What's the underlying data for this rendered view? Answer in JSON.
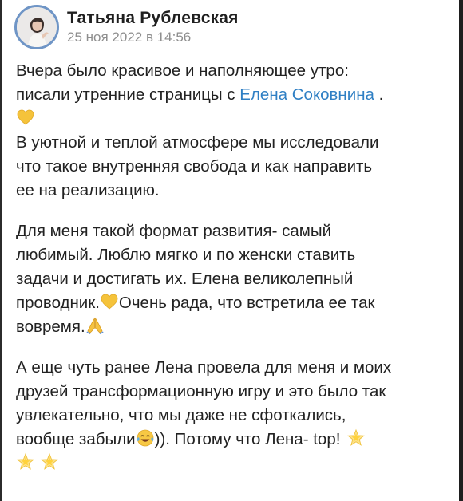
{
  "post": {
    "author": "Татьяна Рублевская",
    "date": "25 ноя 2022 в 14:56",
    "paragraph1": {
      "line1": "Вчера было красивое и наполняющее утро:",
      "line2_pre": "писали утренние страницы с ",
      "mention": "Елена Соковнина",
      "line2_post": " .",
      "line3": "В уютной и теплой атмосфере мы исследовали",
      "line4": "что такое внутренняя свобода и как направить",
      "line5": "ее на реализацию."
    },
    "paragraph2": {
      "line1": "Для меня такой формат развития- самый",
      "line2": "любимый. Люблю мягко и по женски ставить",
      "line3": "задачи и достигать их. Елена великолепный",
      "line4_pre": "проводник.",
      "line4_post": "Очень рада, что встретила ее так",
      "line5": "вовремя."
    },
    "paragraph3": {
      "line1": "А еще чуть ранее Лена провела для меня и моих",
      "line2": "друзей трансформационную игру и это было так",
      "line3": "увлекательно, что мы даже не сфоткались,",
      "line4_pre": "вообще забыли",
      "line4_post": ")). Потому что Лена- top! "
    }
  },
  "icons": {
    "avatar": "author-photo",
    "heart": "yellow-heart-icon",
    "pray": "folded-hands-icon",
    "laugh": "tears-of-joy-icon",
    "star": "glowing-star-icon"
  },
  "colors": {
    "link": "#2f7fc4",
    "avatar_ring": "#6f95c6",
    "date": "#8e8e8e",
    "heart": "#f5c33b"
  }
}
